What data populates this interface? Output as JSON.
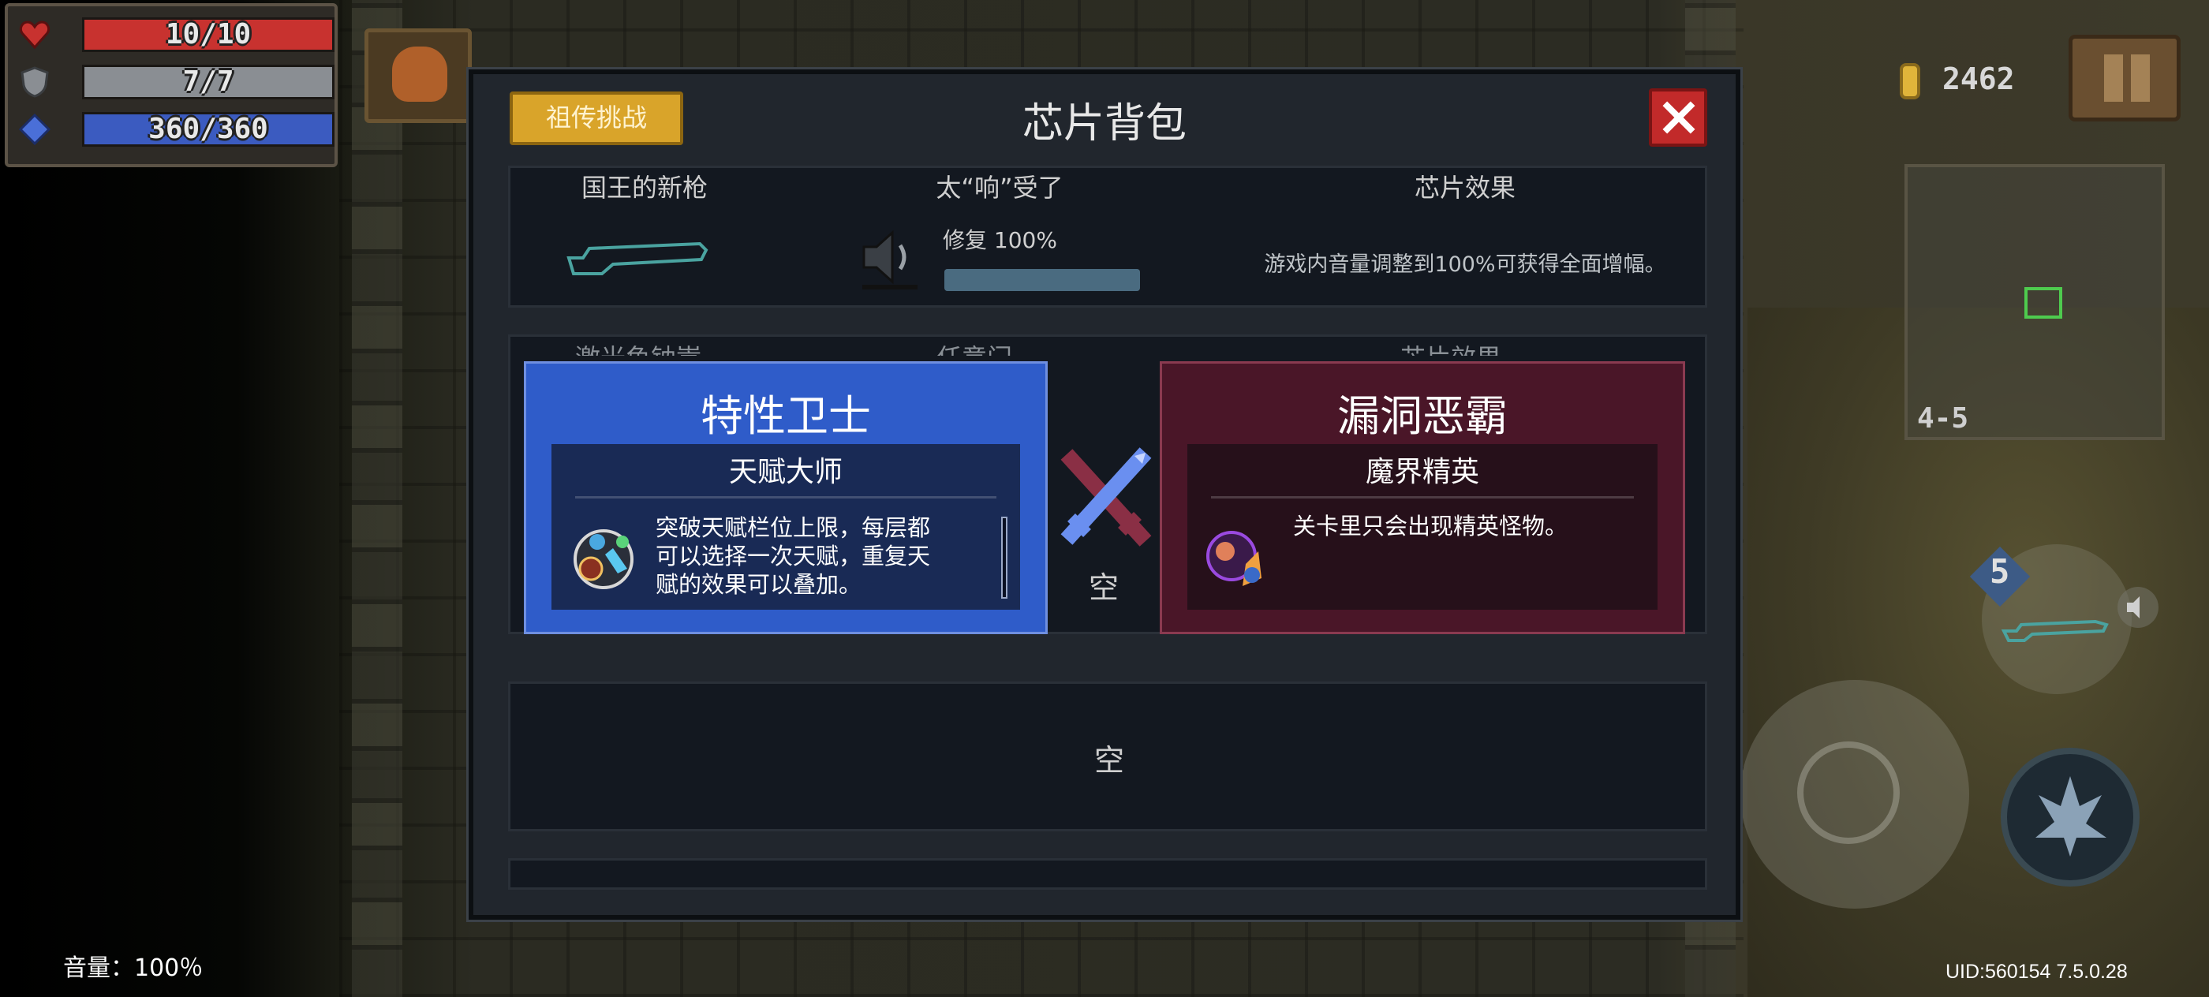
{
  "hud": {
    "hp": "10/10",
    "armor": "7/7",
    "energy": "360/360",
    "hp_fill": 1.0,
    "armor_fill": 1.0,
    "energy_fill": 1.0,
    "coins": "2462",
    "level": "4-5",
    "weapon_energy_cost": "5"
  },
  "modal": {
    "title": "芯片背包",
    "challenge_button": "祖传挑战",
    "slot1": {
      "weapon_name": "国王的新枪",
      "chip_name": "太“响”受了",
      "effect_header": "芯片效果",
      "progress_label": "修复 100%",
      "progress_value": 1.0,
      "effect_text": "游戏内音量调整到100%可获得全面增幅。"
    },
    "slot2": {
      "weapon_name_partial": "激光鱼钠嵩",
      "chip_name_partial": "任意门",
      "effect_header_partial": "芯片效果"
    },
    "empty_slot_a": "空",
    "empty_slot_b": "空"
  },
  "vs": {
    "left": {
      "title": "特性卫士",
      "subtitle": "天赋大师",
      "description_lines": [
        "突破天赋栏位上限，每层都",
        "可以选择一次天赋，重复天",
        "赋的效果可以叠加。"
      ]
    },
    "right": {
      "title": "漏洞恶霸",
      "subtitle": "魔界精英",
      "description": "关卡里只会出现精英怪物。"
    }
  },
  "footer": {
    "volume": "音量：100％",
    "uid": "UID:560154 7.5.0.28"
  },
  "colors": {
    "hp_bar": "#c8322f",
    "armor_bar": "#8a8e93",
    "energy_bar": "#3b5bc0",
    "card_left": "#2f5cc9",
    "card_right": "#4a1628",
    "challenge_button": "#d9a42a",
    "close_button": "#c22a2a"
  }
}
